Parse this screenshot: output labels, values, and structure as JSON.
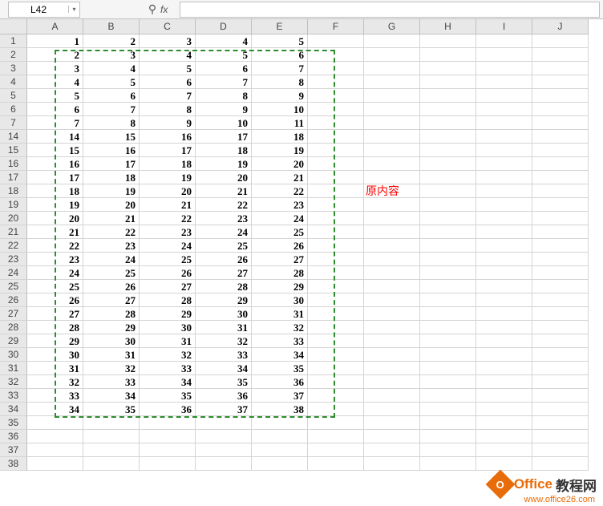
{
  "namebox": {
    "value": "L42"
  },
  "fx_label": "fx",
  "formula": "",
  "columns": [
    "A",
    "B",
    "C",
    "D",
    "E",
    "F",
    "G",
    "H",
    "I",
    "J"
  ],
  "col_widths": [
    "wA",
    "wB",
    "wC",
    "wD",
    "wE",
    "wF",
    "wG",
    "wH",
    "wI",
    "wJ"
  ],
  "visible_row_nums": [
    "1",
    "2",
    "3",
    "4",
    "5",
    "6",
    "7",
    "14",
    "15",
    "16",
    "17",
    "18",
    "19",
    "20",
    "21",
    "22",
    "23",
    "24",
    "25",
    "26",
    "27",
    "28",
    "29",
    "30",
    "31",
    "32",
    "33",
    "34",
    "35",
    "36",
    "37",
    "38"
  ],
  "data_rows": [
    {
      "row": "1",
      "cells": [
        "1",
        "2",
        "3",
        "4",
        "5"
      ]
    },
    {
      "row": "2",
      "cells": [
        "2",
        "3",
        "4",
        "5",
        "6"
      ]
    },
    {
      "row": "3",
      "cells": [
        "3",
        "4",
        "5",
        "6",
        "7"
      ]
    },
    {
      "row": "4",
      "cells": [
        "4",
        "5",
        "6",
        "7",
        "8"
      ]
    },
    {
      "row": "5",
      "cells": [
        "5",
        "6",
        "7",
        "8",
        "9"
      ]
    },
    {
      "row": "6",
      "cells": [
        "6",
        "7",
        "8",
        "9",
        "10"
      ]
    },
    {
      "row": "7",
      "cells": [
        "7",
        "8",
        "9",
        "10",
        "11"
      ]
    },
    {
      "row": "14",
      "cells": [
        "14",
        "15",
        "16",
        "17",
        "18"
      ]
    },
    {
      "row": "15",
      "cells": [
        "15",
        "16",
        "17",
        "18",
        "19"
      ]
    },
    {
      "row": "16",
      "cells": [
        "16",
        "17",
        "18",
        "19",
        "20"
      ]
    },
    {
      "row": "17",
      "cells": [
        "17",
        "18",
        "19",
        "20",
        "21"
      ]
    },
    {
      "row": "18",
      "cells": [
        "18",
        "19",
        "20",
        "21",
        "22"
      ]
    },
    {
      "row": "19",
      "cells": [
        "19",
        "20",
        "21",
        "22",
        "23"
      ]
    },
    {
      "row": "20",
      "cells": [
        "20",
        "21",
        "22",
        "23",
        "24"
      ]
    },
    {
      "row": "21",
      "cells": [
        "21",
        "22",
        "23",
        "24",
        "25"
      ]
    },
    {
      "row": "22",
      "cells": [
        "22",
        "23",
        "24",
        "25",
        "26"
      ]
    },
    {
      "row": "23",
      "cells": [
        "23",
        "24",
        "25",
        "26",
        "27"
      ]
    },
    {
      "row": "24",
      "cells": [
        "24",
        "25",
        "26",
        "27",
        "28"
      ]
    },
    {
      "row": "25",
      "cells": [
        "25",
        "26",
        "27",
        "28",
        "29"
      ]
    },
    {
      "row": "26",
      "cells": [
        "26",
        "27",
        "28",
        "29",
        "30"
      ]
    },
    {
      "row": "27",
      "cells": [
        "27",
        "28",
        "29",
        "30",
        "31"
      ]
    },
    {
      "row": "28",
      "cells": [
        "28",
        "29",
        "30",
        "31",
        "32"
      ]
    },
    {
      "row": "29",
      "cells": [
        "29",
        "30",
        "31",
        "32",
        "33"
      ]
    },
    {
      "row": "30",
      "cells": [
        "30",
        "31",
        "32",
        "33",
        "34"
      ]
    },
    {
      "row": "31",
      "cells": [
        "31",
        "32",
        "33",
        "34",
        "35"
      ]
    },
    {
      "row": "32",
      "cells": [
        "32",
        "33",
        "34",
        "35",
        "36"
      ]
    },
    {
      "row": "33",
      "cells": [
        "33",
        "34",
        "35",
        "36",
        "37"
      ]
    },
    {
      "row": "34",
      "cells": [
        "34",
        "35",
        "36",
        "37",
        "38"
      ]
    }
  ],
  "label": {
    "row": "18",
    "col": "G",
    "text": "原内容"
  },
  "watermark": {
    "icon_text": "O",
    "text1": "Office",
    "text2": "教程网",
    "url": "www.office26.com"
  }
}
